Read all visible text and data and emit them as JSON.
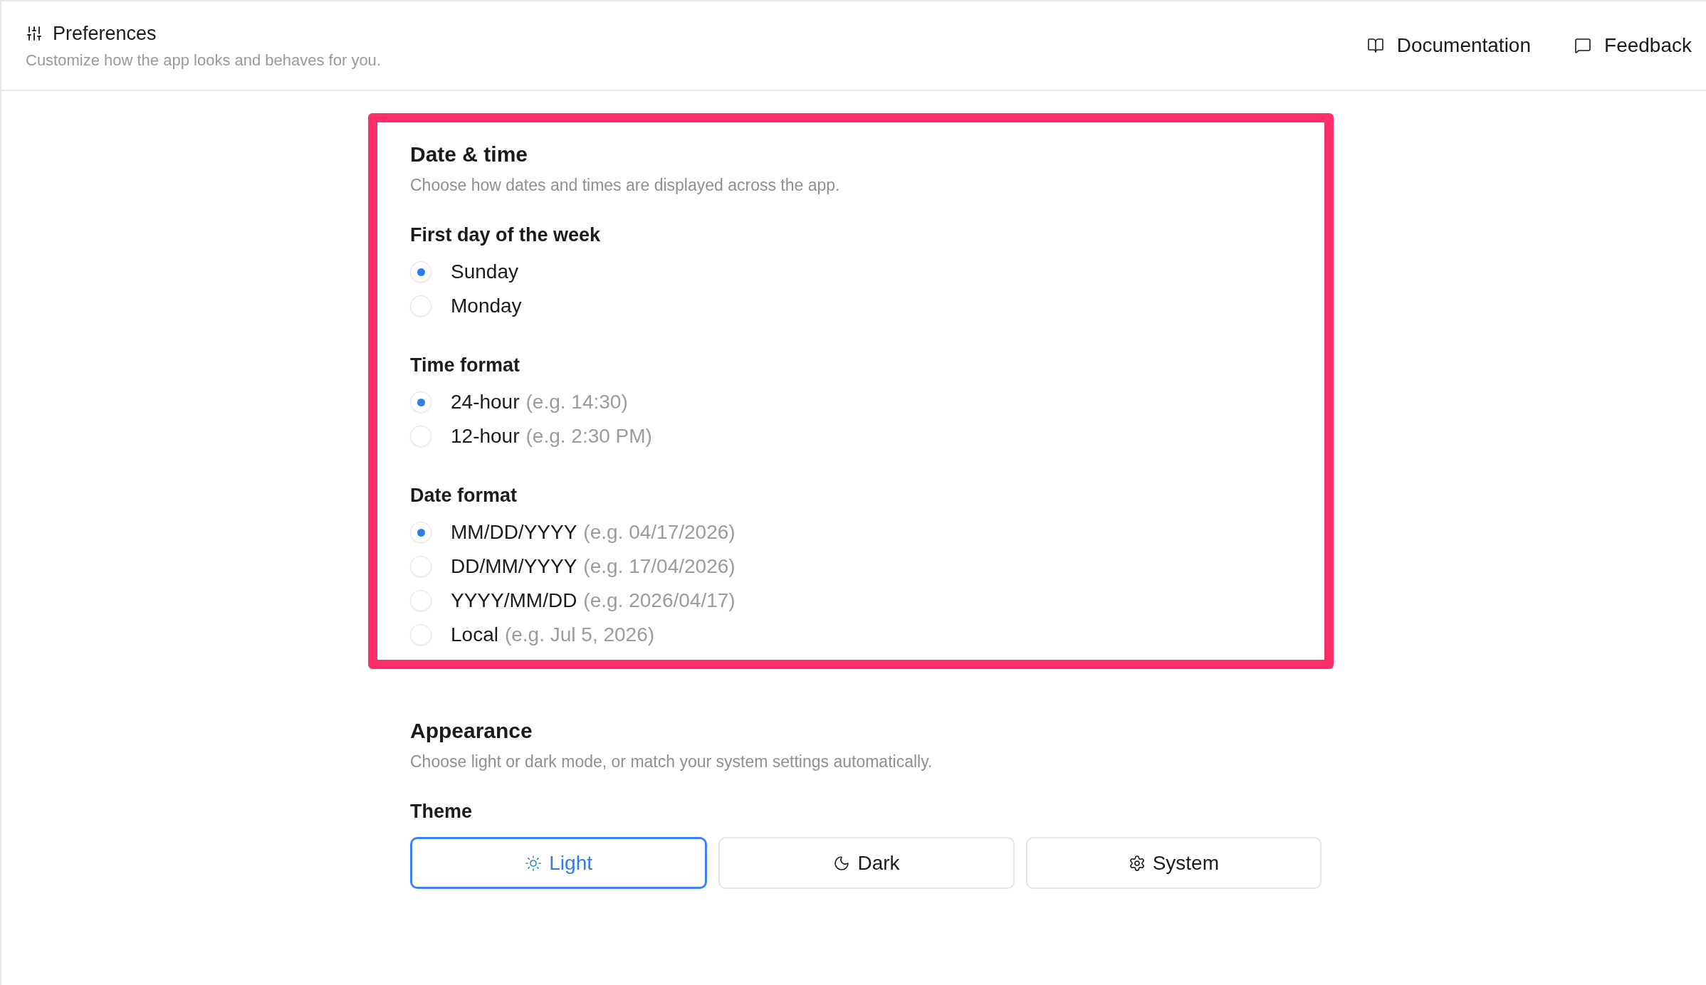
{
  "header": {
    "title": "Preferences",
    "subtitle": "Customize how the app looks and behaves for you.",
    "links": [
      {
        "label": "Documentation"
      },
      {
        "label": "Feedback"
      }
    ]
  },
  "sections": [
    {
      "title": "Date & time",
      "description": "Choose how dates and times are displayed across the app.",
      "highlighted": true,
      "groups": [
        {
          "kind": "radio",
          "label": "First day of the week",
          "options": [
            {
              "label": "Sunday",
              "selected": true
            },
            {
              "label": "Monday",
              "selected": false
            }
          ]
        },
        {
          "kind": "radio",
          "label": "Time format",
          "options": [
            {
              "label": "24-hour",
              "hint": "(e.g. 14:30)",
              "selected": true
            },
            {
              "label": "12-hour",
              "hint": "(e.g. 2:30 PM)",
              "selected": false
            }
          ]
        },
        {
          "kind": "radio",
          "label": "Date format",
          "options": [
            {
              "label": "MM/DD/YYYY",
              "hint": "(e.g. 04/17/2026)",
              "selected": true
            },
            {
              "label": "DD/MM/YYYY",
              "hint": "(e.g. 17/04/2026)",
              "selected": false
            },
            {
              "label": "YYYY/MM/DD",
              "hint": "(e.g. 2026/04/17)",
              "selected": false
            },
            {
              "label": "Local",
              "hint": "(e.g. Jul 5, 2026)",
              "selected": false
            }
          ]
        }
      ]
    },
    {
      "title": "Appearance",
      "description": "Choose light or dark mode, or match your system settings automatically.",
      "groups": [
        {
          "kind": "segmented",
          "label": "Theme",
          "options": [
            {
              "label": "Light",
              "selected": true
            },
            {
              "label": "Dark",
              "selected": false
            },
            {
              "label": "System",
              "selected": false
            }
          ]
        }
      ]
    }
  ]
}
